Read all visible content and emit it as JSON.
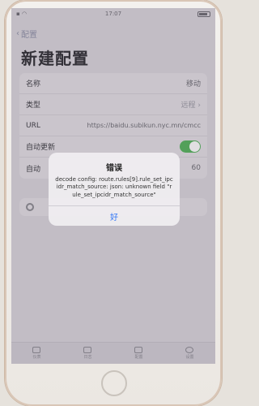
{
  "status_bar": {
    "time": "17:07"
  },
  "nav": {
    "back_label": "配置"
  },
  "title": "新建配置",
  "rows": [
    {
      "label": "名称",
      "value": "移动"
    },
    {
      "label": "类型",
      "value": "远程"
    },
    {
      "label": "URL",
      "value": "https://baidu.subikun.nyc.mn/cmcc"
    },
    {
      "label": "自动更新",
      "toggle": true
    },
    {
      "label": "自动",
      "value": "60"
    }
  ],
  "alert": {
    "title": "错误",
    "message": "decode config: route.rules[9].rule_set_ipcidr_match_source: json: unknown field \"rule_set_ipcidr_match_source\"",
    "ok_label": "好"
  },
  "tabs": [
    {
      "label": "仪表",
      "icon": "dashboard-icon"
    },
    {
      "label": "日志",
      "icon": "document-icon"
    },
    {
      "label": "配置",
      "icon": "profiles-icon"
    },
    {
      "label": "设置",
      "icon": "settings-icon"
    }
  ]
}
